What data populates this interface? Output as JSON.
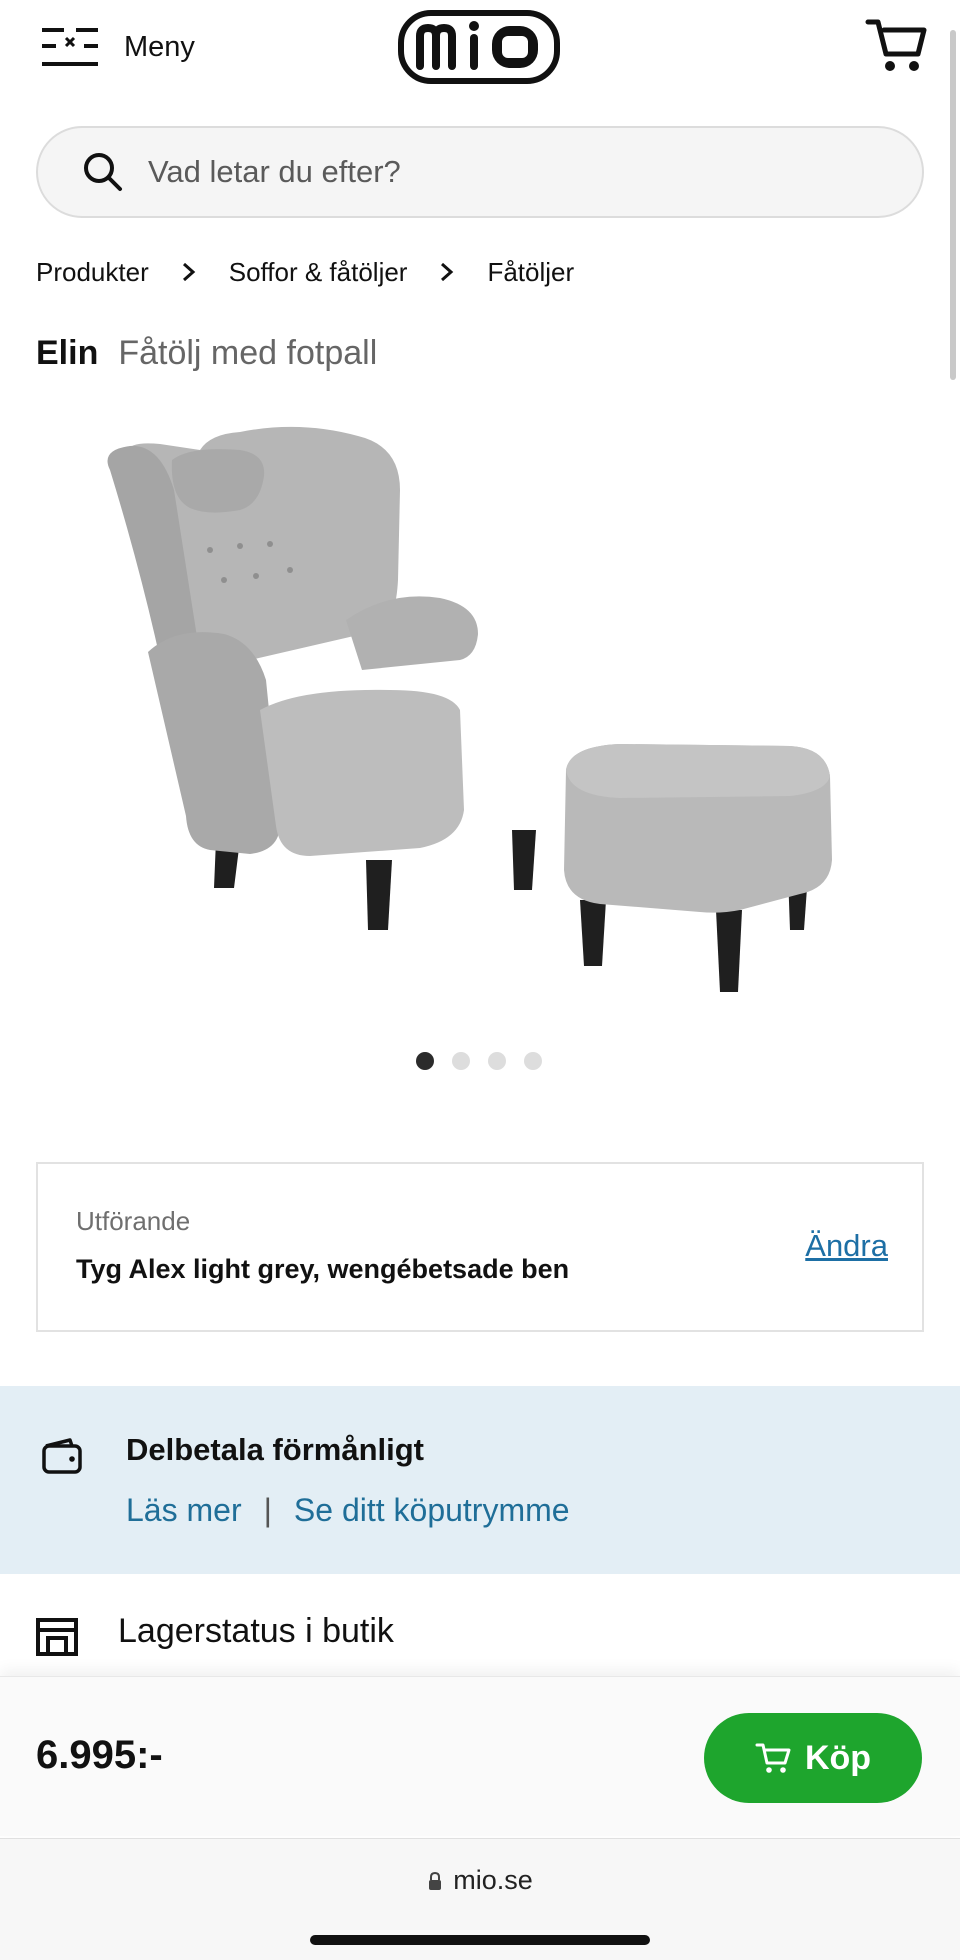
{
  "header": {
    "menu_label": "Meny",
    "logo_text": "mio",
    "menu_icon": "hamburger-menu-icon",
    "cart_icon": "shopping-cart-icon"
  },
  "search": {
    "placeholder": "Vad letar du efter?",
    "icon": "search-icon"
  },
  "breadcrumb": {
    "items": [
      {
        "label": "Produkter"
      },
      {
        "label": "Soffor & fåtöljer"
      },
      {
        "label": "Fåtöljer"
      }
    ],
    "separator_icon": "chevron-right-icon"
  },
  "product": {
    "name": "Elin",
    "description": "Fåtölj med fotpall",
    "image_icon": "armchair-with-footstool-image",
    "carousel": {
      "total": 4,
      "active_index": 1
    },
    "colors": {
      "fabric": "#b9b9b9",
      "legs": "#1f1f1f"
    }
  },
  "variant": {
    "label": "Utförande",
    "value": "Tyg Alex light grey, wengébetsade ben",
    "change_label": "Ändra"
  },
  "payment": {
    "title": "Delbetala förmånligt",
    "link_1": "Läs mer",
    "separator": "|",
    "link_2": "Se ditt köputrymme",
    "icon": "wallet-icon"
  },
  "stock": {
    "label": "Lagerstatus i butik",
    "icon": "store-icon"
  },
  "purchase": {
    "price": "6.995:-",
    "buy_label": "Köp",
    "icon": "cart-icon"
  },
  "browser": {
    "url": "mio.se",
    "icon": "lock-icon"
  },
  "colors": {
    "buy_button": "#1ea52d",
    "banner_bg": "#e3eef5",
    "link": "#1f6e98"
  }
}
